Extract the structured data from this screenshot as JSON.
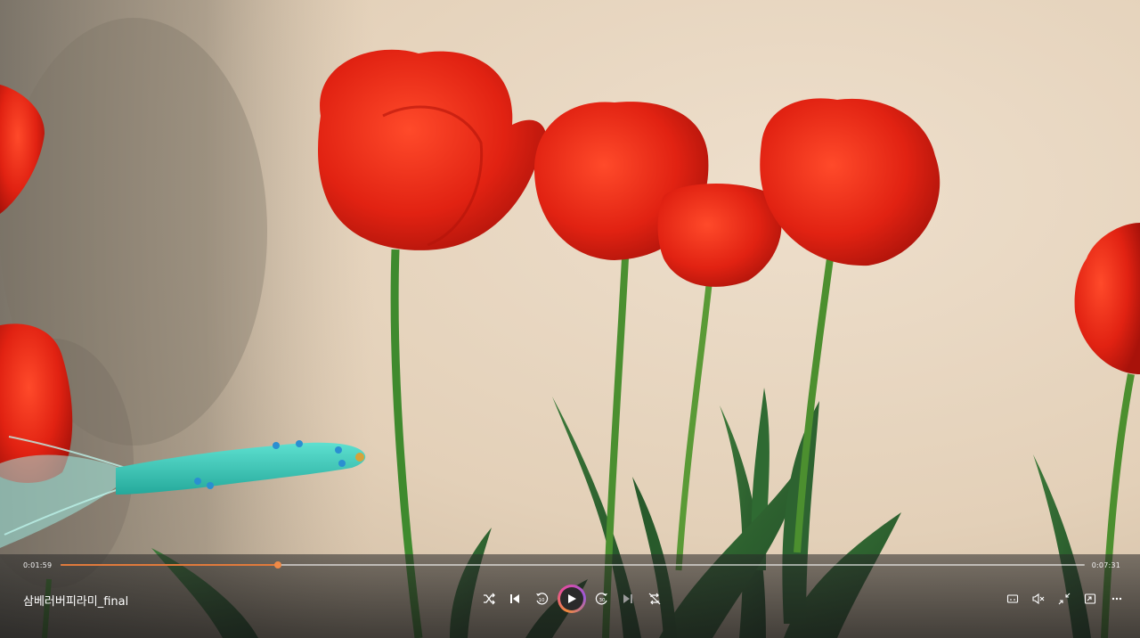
{
  "player": {
    "title": "삼베러버피라미_final",
    "time_current": "0:01:59",
    "time_total": "0:07:31",
    "progress_fraction": 0.212,
    "accent_color": "#e07a3c"
  },
  "controls": {
    "left_group": [
      "shuffle-icon",
      "previous-icon",
      "rewind-10-icon",
      "play-icon",
      "forward-30-icon",
      "next-icon",
      "repeat-off-icon"
    ],
    "right_group": [
      "captions-icon",
      "mute-icon",
      "fullscreen-exit-icon",
      "mini-view-icon",
      "more-icon"
    ]
  }
}
